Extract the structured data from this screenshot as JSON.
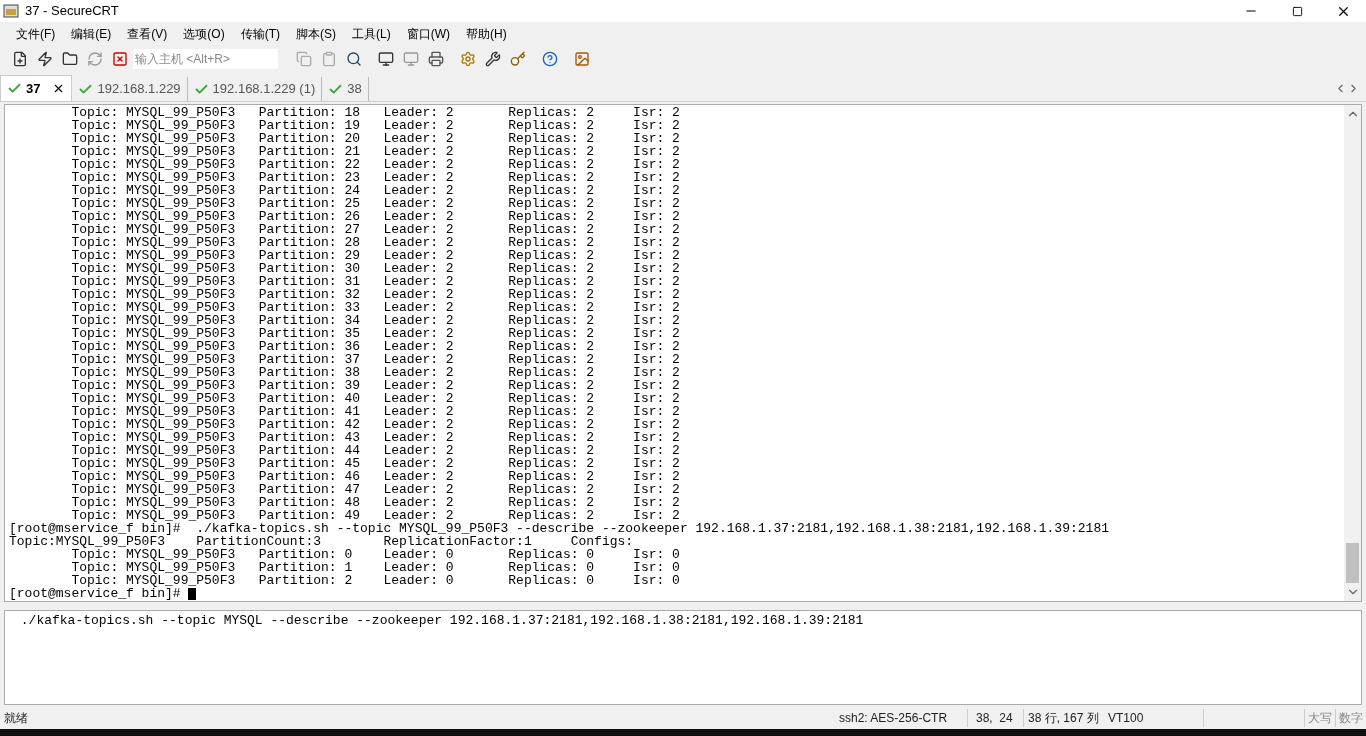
{
  "window": {
    "title": "37 - SecureCRT"
  },
  "menu": [
    "文件(F)",
    "编辑(E)",
    "查看(V)",
    "选项(O)",
    "传输(T)",
    "脚本(S)",
    "工具(L)",
    "窗口(W)",
    "帮助(H)"
  ],
  "toolbar": {
    "host_field": {
      "placeholder": "输入主机 <Alt+R>"
    }
  },
  "tabs": [
    {
      "label": "37",
      "selected": true
    },
    {
      "label": "192.168.1.229",
      "selected": false
    },
    {
      "label": "192.168.1.229 (1)",
      "selected": false
    },
    {
      "label": "38",
      "selected": false
    }
  ],
  "terminal": {
    "lines": [
      "        Topic: MYSQL_99_P50F3   Partition: 18   Leader: 2       Replicas: 2     Isr: 2",
      "        Topic: MYSQL_99_P50F3   Partition: 19   Leader: 2       Replicas: 2     Isr: 2",
      "        Topic: MYSQL_99_P50F3   Partition: 20   Leader: 2       Replicas: 2     Isr: 2",
      "        Topic: MYSQL_99_P50F3   Partition: 21   Leader: 2       Replicas: 2     Isr: 2",
      "        Topic: MYSQL_99_P50F3   Partition: 22   Leader: 2       Replicas: 2     Isr: 2",
      "        Topic: MYSQL_99_P50F3   Partition: 23   Leader: 2       Replicas: 2     Isr: 2",
      "        Topic: MYSQL_99_P50F3   Partition: 24   Leader: 2       Replicas: 2     Isr: 2",
      "        Topic: MYSQL_99_P50F3   Partition: 25   Leader: 2       Replicas: 2     Isr: 2",
      "        Topic: MYSQL_99_P50F3   Partition: 26   Leader: 2       Replicas: 2     Isr: 2",
      "        Topic: MYSQL_99_P50F3   Partition: 27   Leader: 2       Replicas: 2     Isr: 2",
      "        Topic: MYSQL_99_P50F3   Partition: 28   Leader: 2       Replicas: 2     Isr: 2",
      "        Topic: MYSQL_99_P50F3   Partition: 29   Leader: 2       Replicas: 2     Isr: 2",
      "        Topic: MYSQL_99_P50F3   Partition: 30   Leader: 2       Replicas: 2     Isr: 2",
      "        Topic: MYSQL_99_P50F3   Partition: 31   Leader: 2       Replicas: 2     Isr: 2",
      "        Topic: MYSQL_99_P50F3   Partition: 32   Leader: 2       Replicas: 2     Isr: 2",
      "        Topic: MYSQL_99_P50F3   Partition: 33   Leader: 2       Replicas: 2     Isr: 2",
      "        Topic: MYSQL_99_P50F3   Partition: 34   Leader: 2       Replicas: 2     Isr: 2",
      "        Topic: MYSQL_99_P50F3   Partition: 35   Leader: 2       Replicas: 2     Isr: 2",
      "        Topic: MYSQL_99_P50F3   Partition: 36   Leader: 2       Replicas: 2     Isr: 2",
      "        Topic: MYSQL_99_P50F3   Partition: 37   Leader: 2       Replicas: 2     Isr: 2",
      "        Topic: MYSQL_99_P50F3   Partition: 38   Leader: 2       Replicas: 2     Isr: 2",
      "        Topic: MYSQL_99_P50F3   Partition: 39   Leader: 2       Replicas: 2     Isr: 2",
      "        Topic: MYSQL_99_P50F3   Partition: 40   Leader: 2       Replicas: 2     Isr: 2",
      "        Topic: MYSQL_99_P50F3   Partition: 41   Leader: 2       Replicas: 2     Isr: 2",
      "        Topic: MYSQL_99_P50F3   Partition: 42   Leader: 2       Replicas: 2     Isr: 2",
      "        Topic: MYSQL_99_P50F3   Partition: 43   Leader: 2       Replicas: 2     Isr: 2",
      "        Topic: MYSQL_99_P50F3   Partition: 44   Leader: 2       Replicas: 2     Isr: 2",
      "        Topic: MYSQL_99_P50F3   Partition: 45   Leader: 2       Replicas: 2     Isr: 2",
      "        Topic: MYSQL_99_P50F3   Partition: 46   Leader: 2       Replicas: 2     Isr: 2",
      "        Topic: MYSQL_99_P50F3   Partition: 47   Leader: 2       Replicas: 2     Isr: 2",
      "        Topic: MYSQL_99_P50F3   Partition: 48   Leader: 2       Replicas: 2     Isr: 2",
      "        Topic: MYSQL_99_P50F3   Partition: 49   Leader: 2       Replicas: 2     Isr: 2",
      "[root@mservice_f bin]#  ./kafka-topics.sh --topic MYSQL_99_P50F3 --describe --zookeeper 192.168.1.37:2181,192.168.1.38:2181,192.168.1.39:2181",
      "Topic:MYSQL_99_P50F3    PartitionCount:3        ReplicationFactor:1     Configs:",
      "        Topic: MYSQL_99_P50F3   Partition: 0    Leader: 0       Replicas: 0     Isr: 0",
      "        Topic: MYSQL_99_P50F3   Partition: 1    Leader: 0       Replicas: 0     Isr: 0",
      "        Topic: MYSQL_99_P50F3   Partition: 2    Leader: 0       Replicas: 0     Isr: 0"
    ],
    "prompt": "[root@mservice_f bin]# "
  },
  "command_window": {
    "value": " ./kafka-topics.sh --topic MYSQL --describe --zookeeper 192.168.1.37:2181,192.168.1.38:2181,192.168.1.39:2181"
  },
  "status_bar": {
    "state": "就绪",
    "encryption": "ssh2: AES-256-CTR",
    "cursor": "38,  24",
    "size": "38 行, 167 列",
    "emulation": "VT100",
    "caps": "大写",
    "num": "数字"
  }
}
